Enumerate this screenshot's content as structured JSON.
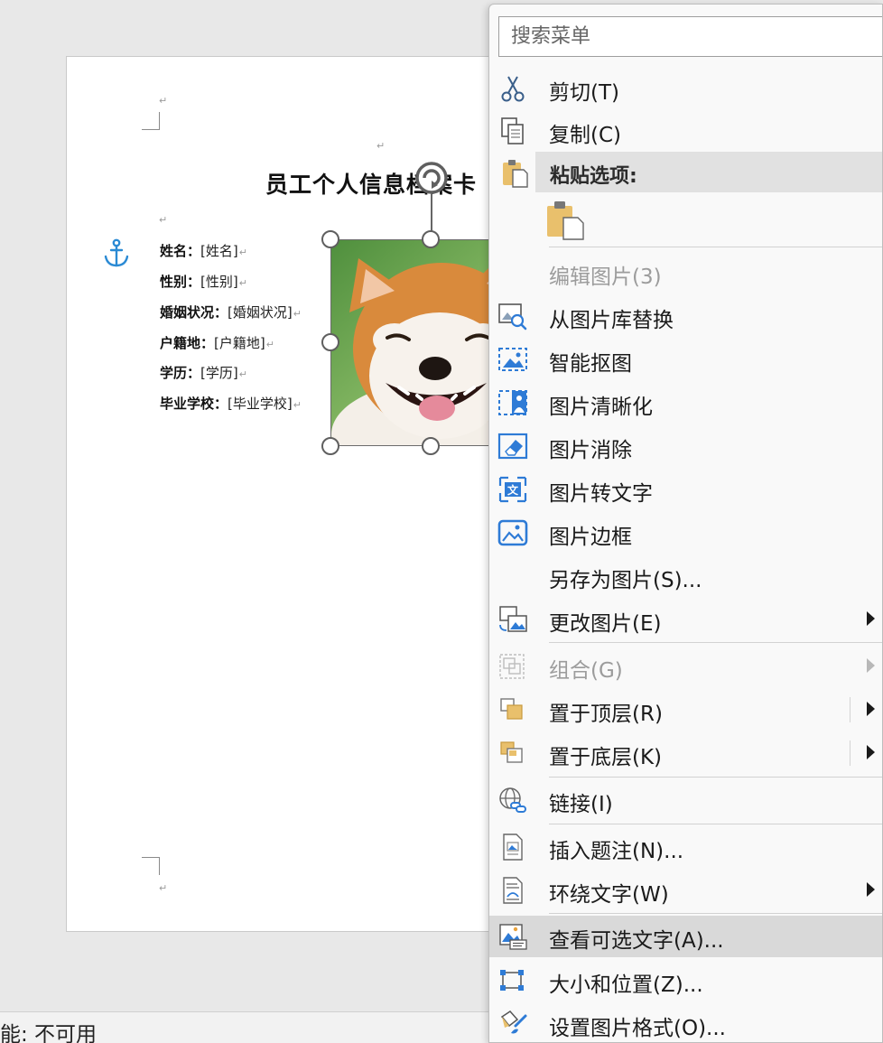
{
  "document": {
    "title": "员工个人信息档案卡",
    "paragraph_mark": "↵",
    "fields": [
      {
        "label": "姓名：",
        "value": "[姓名]"
      },
      {
        "label": "性别：",
        "value": "[性别]"
      },
      {
        "label": "婚姻状况：",
        "value": "[婚姻状况]"
      },
      {
        "label": "户籍地：",
        "value": "[户籍地]"
      },
      {
        "label": "学历：",
        "value": "[学历]"
      },
      {
        "label": "毕业学校：",
        "value": "[毕业学校]"
      }
    ]
  },
  "status_bar": {
    "text": "能: 不可用"
  },
  "context_menu": {
    "search_placeholder": "搜索菜单",
    "paste_options_label": "粘贴选项:",
    "items": [
      {
        "label": "剪切(T)",
        "icon": "scissors-icon"
      },
      {
        "label": "复制(C)",
        "icon": "copy-icon"
      },
      {
        "label": "编辑图片(3)",
        "icon": "",
        "disabled": true
      },
      {
        "label": "从图片库替换",
        "icon": "image-search-icon"
      },
      {
        "label": "智能抠图",
        "icon": "smart-cutout-icon"
      },
      {
        "label": "图片清晰化",
        "icon": "image-enhance-icon"
      },
      {
        "label": "图片消除",
        "icon": "eraser-icon"
      },
      {
        "label": "图片转文字",
        "icon": "image-to-text-icon"
      },
      {
        "label": "图片边框",
        "icon": "image-border-icon"
      },
      {
        "label": "另存为图片(S)...",
        "icon": ""
      },
      {
        "label": "更改图片(E)",
        "icon": "change-picture-icon",
        "submenu": true
      },
      {
        "label": "组合(G)",
        "icon": "group-icon",
        "disabled": true,
        "submenu": true
      },
      {
        "label": "置于顶层(R)",
        "icon": "bring-to-front-icon",
        "submenu": true
      },
      {
        "label": "置于底层(K)",
        "icon": "send-to-back-icon",
        "submenu": true
      },
      {
        "label": "链接(I)",
        "icon": "link-icon"
      },
      {
        "label": "插入题注(N)...",
        "icon": "insert-caption-icon"
      },
      {
        "label": "环绕文字(W)",
        "icon": "wrap-text-icon",
        "submenu": true
      },
      {
        "label": "查看可选文字(A)...",
        "icon": "alt-text-icon",
        "highlighted": true
      },
      {
        "label": "大小和位置(Z)...",
        "icon": "size-position-icon"
      },
      {
        "label": "设置图片格式(O)...",
        "icon": "format-picture-icon"
      }
    ]
  },
  "colors": {
    "accent_blue": "#2e7bd6",
    "paste_yellow": "#e9c06c",
    "highlight": "#d9d9d9"
  }
}
